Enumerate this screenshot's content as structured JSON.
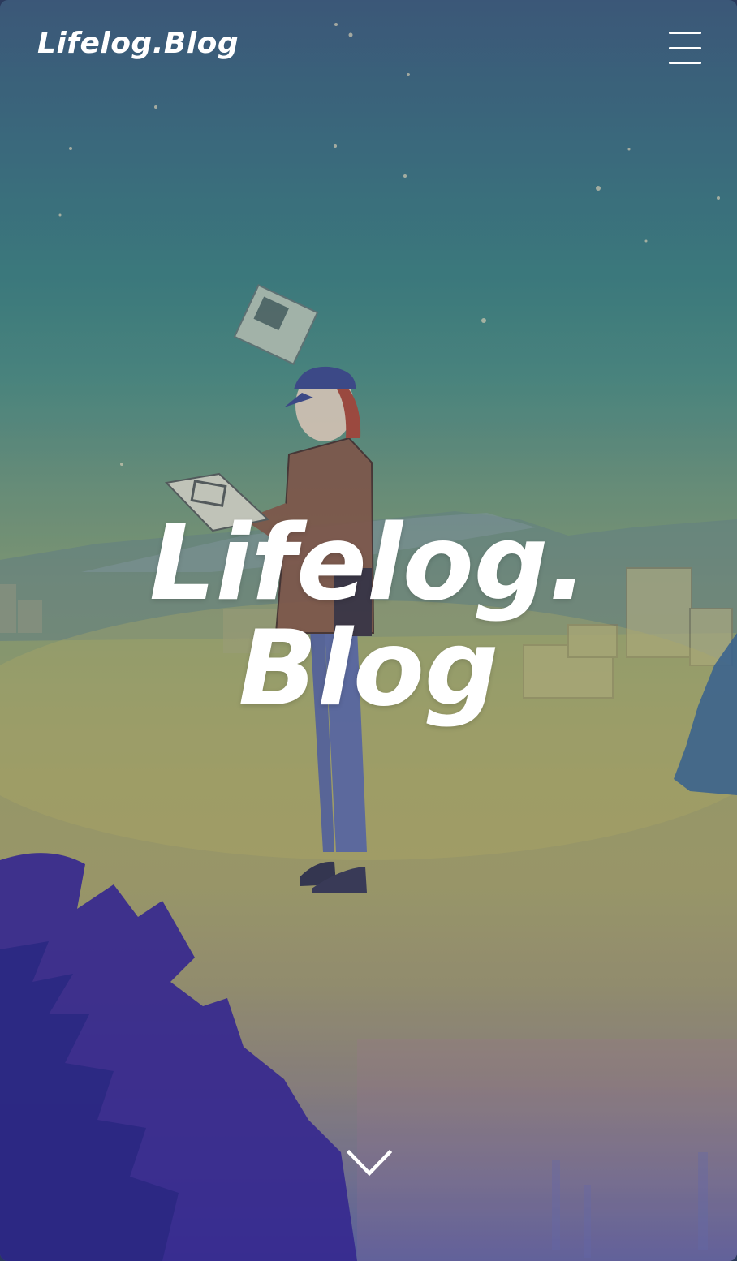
{
  "header": {
    "logo_text": "Lifelog.Blog",
    "menu_icon": "hamburger-menu-icon"
  },
  "hero": {
    "title_line1": "Lifelog.",
    "title_line2": "Blog",
    "scroll_icon": "chevron-down-icon"
  },
  "colors": {
    "text": "#ffffff",
    "sky_top": "#3f5f80",
    "ground": "#a9a66e",
    "foliage": "#3a2a9a"
  }
}
